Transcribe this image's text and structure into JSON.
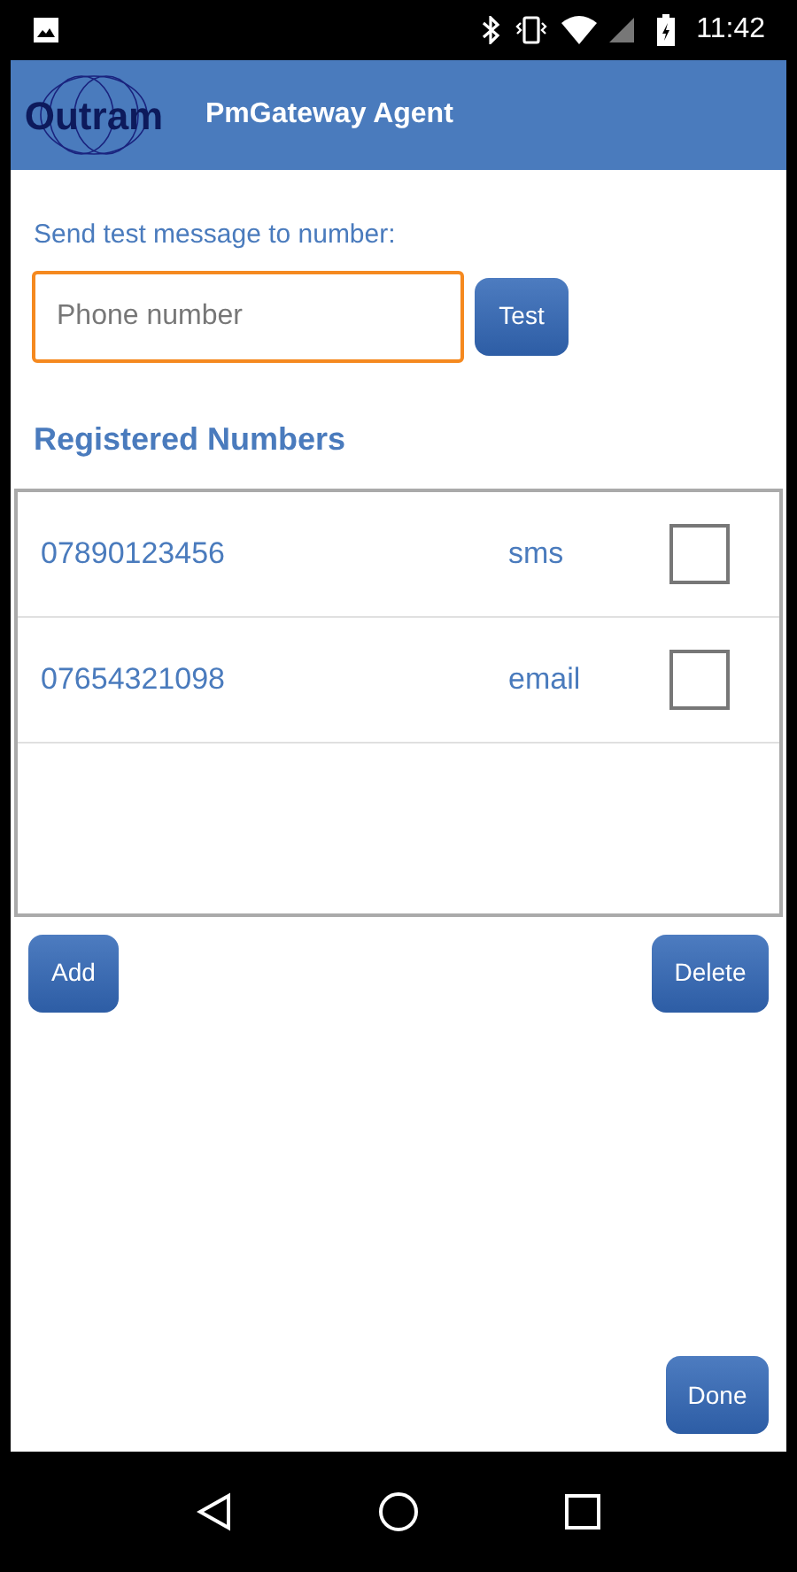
{
  "status_bar": {
    "time": "11:42"
  },
  "app_bar": {
    "logo_text": "Outram",
    "title": "PmGateway Agent"
  },
  "test_message": {
    "label": "Send test message to number:",
    "phone_field": {
      "placeholder": "Phone number",
      "focused": true
    },
    "button": "Test"
  },
  "registered_numbers": {
    "heading": "Registered Numbers",
    "rows": [
      {
        "number": "07890123456",
        "channel": "sms",
        "checked": false
      },
      {
        "number": "07654321098",
        "channel": "email",
        "checked": false
      }
    ]
  },
  "buttons": {
    "add": "Add",
    "delete": "Delete",
    "done": "Done"
  }
}
